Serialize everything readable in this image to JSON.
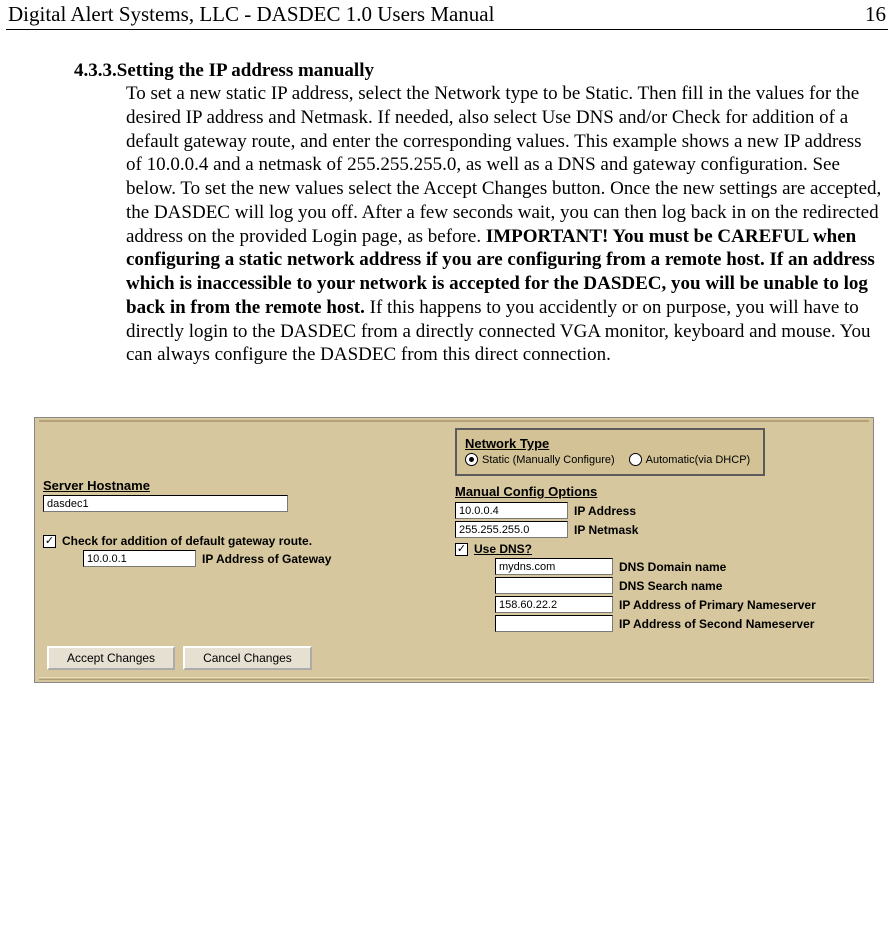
{
  "doc": {
    "header_left": "Digital Alert Systems, LLC - DASDEC 1.0 Users Manual",
    "page_num": "16",
    "section_num": "4.3.3.",
    "section_title": "Setting the IP address manually",
    "para_a": "To set a new static IP address, select the Network type to be Static. Then fill in the values for the desired IP address and Netmask. If needed, also select Use DNS and/or Check for addition of a default gateway route, and enter the corresponding values. This example shows a new IP address of 10.0.0.4 and a netmask of 255.255.255.0, as well as a DNS and gateway configuration. See below. To set the new values select the Accept Changes button. Once the new settings are accepted, the DASDEC will log you off. After a few seconds wait, you can then log back in on the redirected address on the provided Login page, as before. ",
    "para_bold": "IMPORTANT! You must be CAREFUL when configuring a static network address if you are configuring from a remote host. If an address which is inaccessible to your network is accepted for the DASDEC, you will be unable to log back in from the remote host.",
    "para_b": " If this happens to you accidently or on purpose, you will have to directly login to the DASDEC from a directly connected VGA monitor, keyboard and mouse. You can always configure the DASDEC from this direct connection."
  },
  "ui": {
    "server_hostname_label": "Server Hostname",
    "server_hostname_value": "dasdec1",
    "gateway_check_label": "Check for addition of default gateway route.",
    "gateway_ip_value": "10.0.0.1",
    "gateway_ip_label": "IP Address of Gateway",
    "network_type_label": "Network Type",
    "radio_static": "Static (Manually Configure)",
    "radio_dhcp": "Automatic(via DHCP)",
    "manual_config_label": "Manual Config Options",
    "ip_address_value": "10.0.0.4",
    "ip_address_label": "IP Address",
    "ip_netmask_value": "255.255.255.0",
    "ip_netmask_label": "IP Netmask",
    "use_dns_label": "Use DNS?",
    "dns_domain_value": "mydns.com",
    "dns_domain_label": "DNS Domain name",
    "dns_search_value": "",
    "dns_search_label": "DNS Search name",
    "dns_primary_value": "158.60.22.2",
    "dns_primary_label": "IP Address of Primary Nameserver",
    "dns_secondary_value": "",
    "dns_secondary_label": "IP Address of Second Nameserver",
    "btn_accept": "Accept Changes",
    "btn_cancel": "Cancel Changes"
  }
}
